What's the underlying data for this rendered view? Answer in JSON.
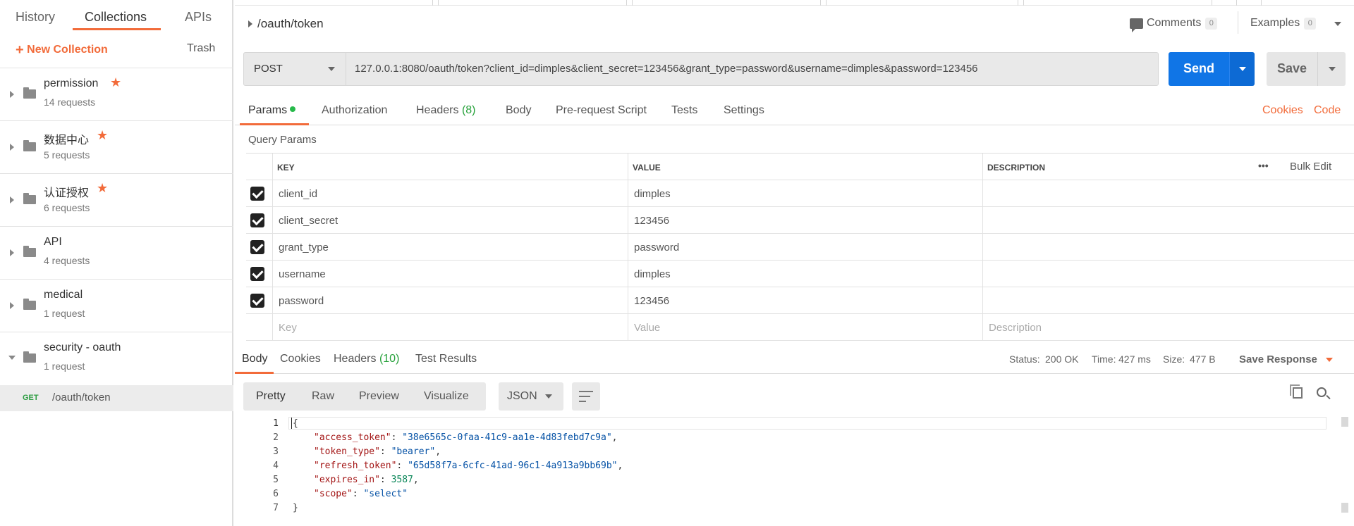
{
  "sidebar": {
    "tabs": [
      "History",
      "Collections",
      "APIs"
    ],
    "new_collection": "New Collection",
    "trash": "Trash",
    "collections": [
      {
        "name": "permission",
        "count": "14 requests",
        "starred": true
      },
      {
        "name": "数据中心",
        "count": "5 requests",
        "starred": true
      },
      {
        "name": "认证授权",
        "count": "6 requests",
        "starred": true
      },
      {
        "name": "API",
        "count": "4 requests",
        "starred": false
      },
      {
        "name": "medical",
        "count": "1 request",
        "starred": false
      },
      {
        "name": "security - oauth",
        "count": "1 request",
        "starred": false
      }
    ],
    "request": {
      "method": "GET",
      "path": "/oauth/token"
    }
  },
  "header": {
    "title": "/oauth/token",
    "comments_label": "Comments",
    "comments_count": "0",
    "examples_label": "Examples",
    "examples_count": "0"
  },
  "request": {
    "method": "POST",
    "url": "127.0.0.1:8080/oauth/token?client_id=dimples&client_secret=123456&grant_type=password&username=dimples&password=123456",
    "send": "Send",
    "save": "Save"
  },
  "req_tabs": {
    "params": "Params",
    "authorization": "Authorization",
    "headers": "Headers",
    "headers_count": "(8)",
    "body": "Body",
    "prerequest": "Pre-request Script",
    "tests": "Tests",
    "settings": "Settings",
    "cookies": "Cookies",
    "code": "Code"
  },
  "params": {
    "section_label": "Query Params",
    "columns": [
      "KEY",
      "VALUE",
      "DESCRIPTION"
    ],
    "bulk_edit": "Bulk Edit",
    "more": "•••",
    "rows": [
      {
        "key": "client_id",
        "value": "dimples",
        "description": ""
      },
      {
        "key": "client_secret",
        "value": "123456",
        "description": ""
      },
      {
        "key": "grant_type",
        "value": "password",
        "description": ""
      },
      {
        "key": "username",
        "value": "dimples",
        "description": ""
      },
      {
        "key": "password",
        "value": "123456",
        "description": ""
      }
    ],
    "placeholder": {
      "key": "Key",
      "value": "Value",
      "description": "Description"
    }
  },
  "response": {
    "tabs": {
      "body": "Body",
      "cookies": "Cookies",
      "headers": "Headers",
      "headers_count": "(10)",
      "tests": "Test Results"
    },
    "status_label": "Status:",
    "status": "200 OK",
    "time_label": "Time:",
    "time": "427 ms",
    "size_label": "Size:",
    "size": "477 B",
    "save_response": "Save Response",
    "views": [
      "Pretty",
      "Raw",
      "Preview",
      "Visualize"
    ],
    "format": "JSON",
    "line_numbers": [
      "1",
      "2",
      "3",
      "4",
      "5",
      "6",
      "7"
    ],
    "json": {
      "open": "{",
      "close": "}",
      "fields": [
        {
          "key": "\"access_token\"",
          "value": "\"38e6565c-0faa-41c9-aa1e-4d83febd7c9a\"",
          "type": "s",
          "comma": ","
        },
        {
          "key": "\"token_type\"",
          "value": "\"bearer\"",
          "type": "s",
          "comma": ","
        },
        {
          "key": "\"refresh_token\"",
          "value": "\"65d58f7a-6cfc-41ad-96c1-4a913a9bb69b\"",
          "type": "s",
          "comma": ","
        },
        {
          "key": "\"expires_in\"",
          "value": "3587",
          "type": "n",
          "comma": ","
        },
        {
          "key": "\"scope\"",
          "value": "\"select\"",
          "type": "s",
          "comma": ""
        }
      ]
    }
  }
}
